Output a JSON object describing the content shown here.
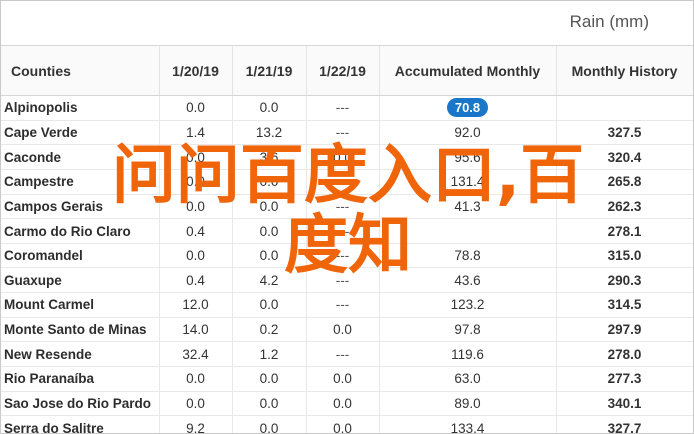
{
  "header": {
    "title": "Rain (mm)"
  },
  "columns": {
    "counties": "Counties",
    "d1": "1/20/19",
    "d2": "1/21/19",
    "d3": "1/22/19",
    "acc": "Accumulated Monthly",
    "mh": "Monthly History"
  },
  "rows": [
    {
      "name": "Alpinopolis",
      "d1": "0.0",
      "d2": "0.0",
      "d3": "---",
      "acc": "70.8",
      "mh": ""
    },
    {
      "name": "Cape Verde",
      "d1": "1.4",
      "d2": "13.2",
      "d3": "---",
      "acc": "92.0",
      "mh": "327.5"
    },
    {
      "name": "Caconde",
      "d1": "0.0",
      "d2": "3.6",
      "d3": "0.0",
      "acc": "95.6",
      "mh": "320.4"
    },
    {
      "name": "Campestre",
      "d1": "0.0",
      "d2": "0.0",
      "d3": "---",
      "acc": "131.4",
      "mh": "265.8"
    },
    {
      "name": "Campos Gerais",
      "d1": "0.0",
      "d2": "0.0",
      "d3": "---",
      "acc": "41.3",
      "mh": "262.3"
    },
    {
      "name": "Carmo do Rio Claro",
      "d1": "0.4",
      "d2": "0.0",
      "d3": "---",
      "acc": "",
      "mh": "278.1"
    },
    {
      "name": "Coromandel",
      "d1": "0.0",
      "d2": "0.0",
      "d3": "---",
      "acc": "78.8",
      "mh": "315.0"
    },
    {
      "name": "Guaxupe",
      "d1": "0.4",
      "d2": "4.2",
      "d3": "---",
      "acc": "43.6",
      "mh": "290.3"
    },
    {
      "name": "Mount Carmel",
      "d1": "12.0",
      "d2": "0.0",
      "d3": "---",
      "acc": "123.2",
      "mh": "314.5"
    },
    {
      "name": "Monte Santo de Minas",
      "d1": "14.0",
      "d2": "0.2",
      "d3": "0.0",
      "acc": "97.8",
      "mh": "297.9"
    },
    {
      "name": "New Resende",
      "d1": "32.4",
      "d2": "1.2",
      "d3": "---",
      "acc": "119.6",
      "mh": "278.0"
    },
    {
      "name": "Rio Paranaíba",
      "d1": "0.0",
      "d2": "0.0",
      "d3": "0.0",
      "acc": "63.0",
      "mh": "277.3"
    },
    {
      "name": "Sao Jose do Rio Pardo",
      "d1": "0.0",
      "d2": "0.0",
      "d3": "0.0",
      "acc": "89.0",
      "mh": "340.1"
    },
    {
      "name": "Serra do Salitre",
      "d1": "9.2",
      "d2": "0.0",
      "d3": "0.0",
      "acc": "133.4",
      "mh": "327.7"
    }
  ],
  "colors": {
    "accent": "#1976c8",
    "overlay": "#f0640a"
  },
  "overlay": {
    "line1": "问问百度入口,百",
    "line2": "度知"
  }
}
